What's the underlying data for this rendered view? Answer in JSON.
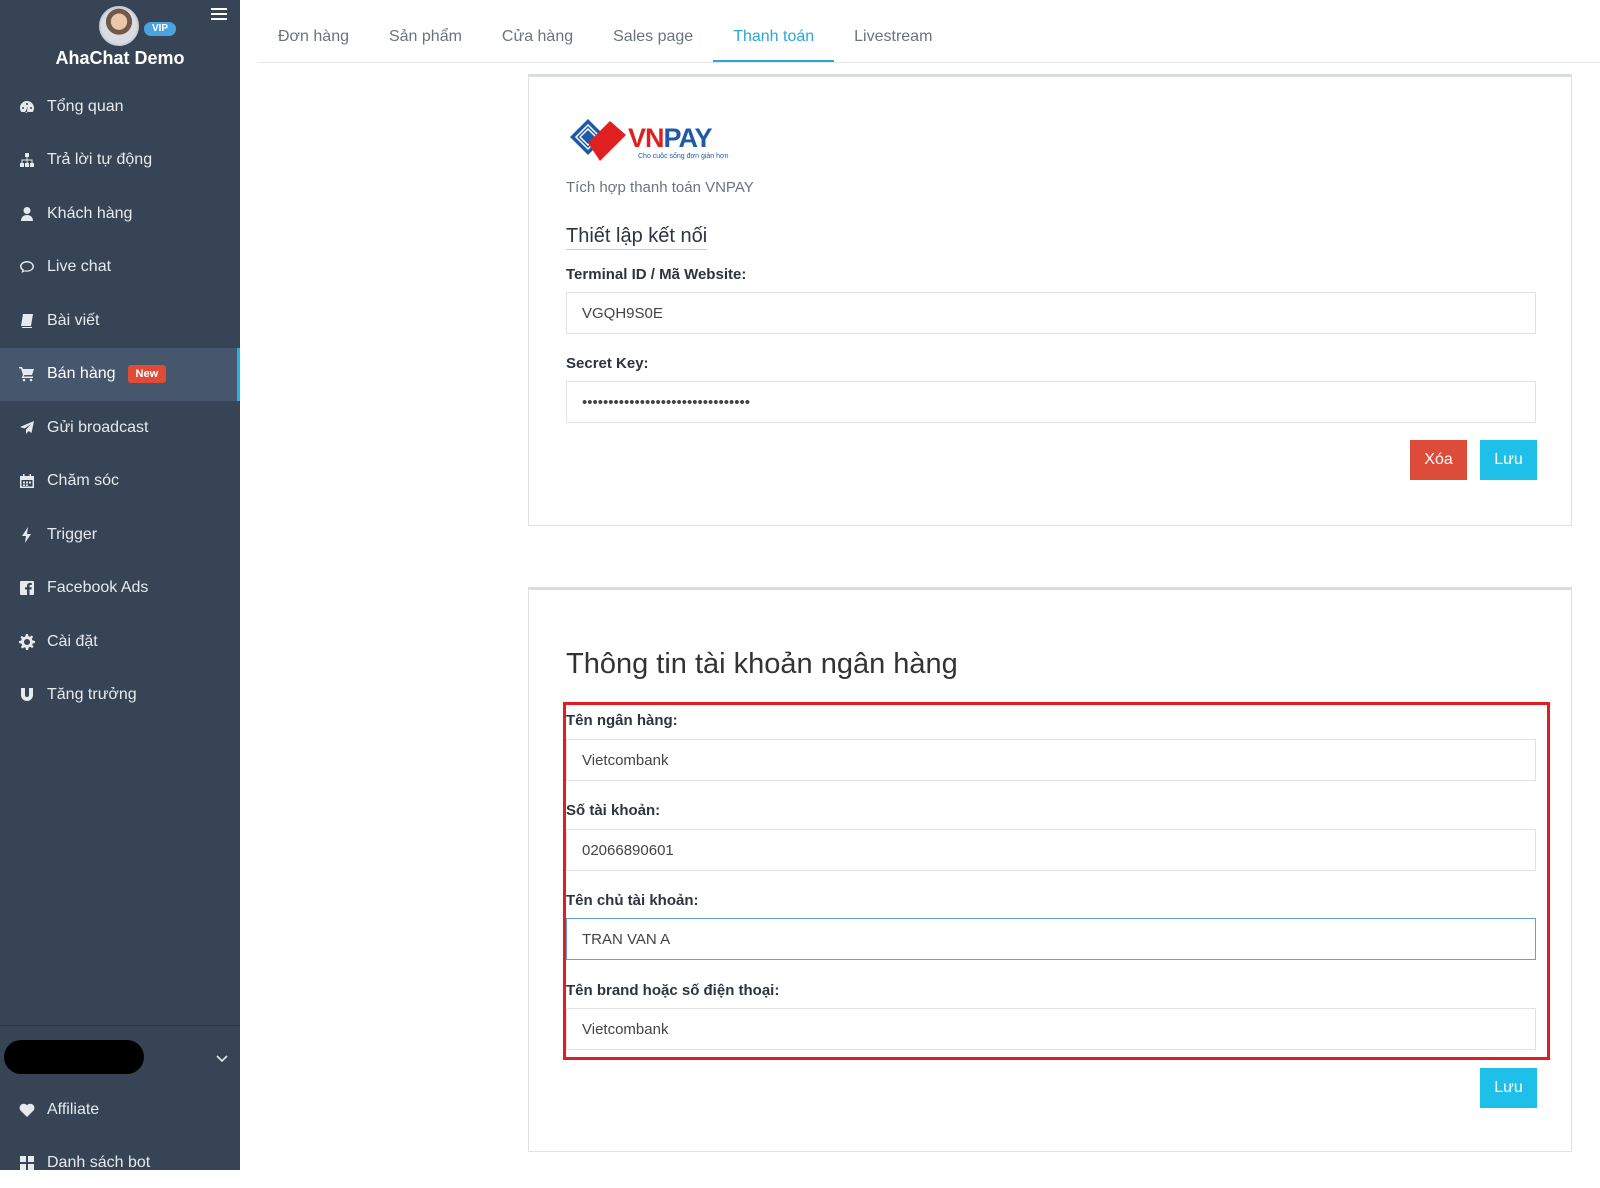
{
  "sidebar": {
    "vip_badge": "VIP",
    "app_name": "AhaChat Demo",
    "items": [
      {
        "label": "Tổng quan",
        "icon": "dashboard-icon"
      },
      {
        "label": "Trả lời tự động",
        "icon": "sitemap-icon"
      },
      {
        "label": "Khách hàng",
        "icon": "user-icon"
      },
      {
        "label": "Live chat",
        "icon": "chat-icon"
      },
      {
        "label": "Bài viết",
        "icon": "book-icon"
      },
      {
        "label": "Bán hàng",
        "icon": "cart-icon",
        "badge": "New",
        "active": true
      },
      {
        "label": "Gửi broadcast",
        "icon": "paper-plane-icon"
      },
      {
        "label": "Chăm sóc",
        "icon": "calendar-icon"
      },
      {
        "label": "Trigger",
        "icon": "bolt-icon"
      },
      {
        "label": "Facebook Ads",
        "icon": "facebook-icon"
      },
      {
        "label": "Cài đặt",
        "icon": "gear-icon"
      },
      {
        "label": "Tăng trưởng",
        "icon": "magnet-icon"
      }
    ],
    "bottom_items": [
      {
        "label": "Affiliate",
        "icon": "heart-icon"
      },
      {
        "label": "Danh sách bot",
        "icon": "grid-icon"
      }
    ]
  },
  "tabs": [
    {
      "label": "Đơn hàng"
    },
    {
      "label": "Sản phẩm"
    },
    {
      "label": "Cửa hàng"
    },
    {
      "label": "Sales page"
    },
    {
      "label": "Thanh toán",
      "active": true
    },
    {
      "label": "Livestream"
    }
  ],
  "vnpay": {
    "logo_vn": "VN",
    "logo_pay": "PAY",
    "logo_tagline": "Cho cuộc sống đơn giản hơn",
    "description": "Tích hợp thanh toán VNPAY",
    "section_title": "Thiết lập kết nối",
    "terminal_label": "Terminal ID / Mã Website:",
    "terminal_value": "VGQH9S0E",
    "secret_label": "Secret Key:",
    "secret_value": "••••••••••••••••••••••••••••••••",
    "delete_button": "Xóa",
    "save_button": "Lưu"
  },
  "bank": {
    "title": "Thông tin tài khoản ngân hàng",
    "bank_name_label": "Tên ngân hàng:",
    "bank_name_value": "Vietcombank",
    "account_number_label": "Số tài khoản:",
    "account_number_value": "02066890601",
    "account_holder_label": "Tên chủ tài khoản:",
    "account_holder_value": "TRAN VAN A",
    "brand_label": "Tên brand hoặc số điện thoại:",
    "brand_value": "Vietcombank",
    "save_button": "Lưu"
  },
  "colors": {
    "sidebar_bg": "#374456",
    "active_tab": "#2aa7d8",
    "danger": "#dd4b39",
    "info": "#1ec0e9",
    "highlight": "#e31b23"
  }
}
